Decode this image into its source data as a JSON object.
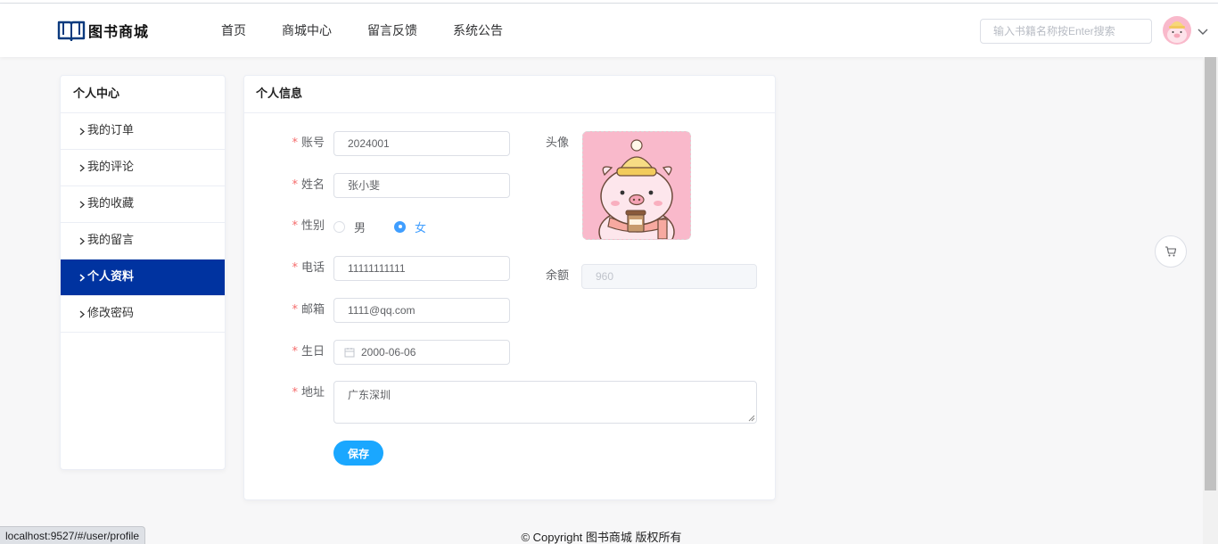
{
  "header": {
    "logo_text": "图书商城",
    "nav": [
      "首页",
      "商城中心",
      "留言反馈",
      "系统公告"
    ],
    "search_placeholder": "输入书籍名称按Enter搜索"
  },
  "sidebar": {
    "title": "个人中心",
    "items": [
      {
        "label": "我的订单",
        "active": false
      },
      {
        "label": "我的评论",
        "active": false
      },
      {
        "label": "我的收藏",
        "active": false
      },
      {
        "label": "我的留言",
        "active": false
      },
      {
        "label": "个人资料",
        "active": true
      },
      {
        "label": "修改密码",
        "active": false
      }
    ]
  },
  "profile": {
    "title": "个人信息",
    "required_mark": "*",
    "account": {
      "label": "账号",
      "value": "2024001"
    },
    "name": {
      "label": "姓名",
      "value": "张小斐"
    },
    "gender": {
      "label": "性别",
      "options": [
        "男",
        "女"
      ],
      "selected": "女"
    },
    "phone": {
      "label": "电话",
      "value": "11111111111"
    },
    "email": {
      "label": "邮箱",
      "value": "1111@qq.com"
    },
    "birthday": {
      "label": "生日",
      "value": "2000-06-06"
    },
    "address": {
      "label": "地址",
      "value": "广东深圳"
    },
    "avatar_label": "头像",
    "balance": {
      "label": "余额",
      "value": "960"
    },
    "save_label": "保存"
  },
  "footer": {
    "text": "© Copyright 图书商城 版权所有"
  },
  "status_bar": {
    "url": "localhost:9527/#/user/profile"
  },
  "colors": {
    "primary": "#0033a0",
    "accent": "#1aa7ff",
    "required": "#f56c6c",
    "radio_checked": "#409eff"
  },
  "icons": [
    "book-logo-icon",
    "chevron-down-icon",
    "chevron-right-icon",
    "calendar-icon",
    "cart-icon",
    "resize-handle-icon"
  ]
}
